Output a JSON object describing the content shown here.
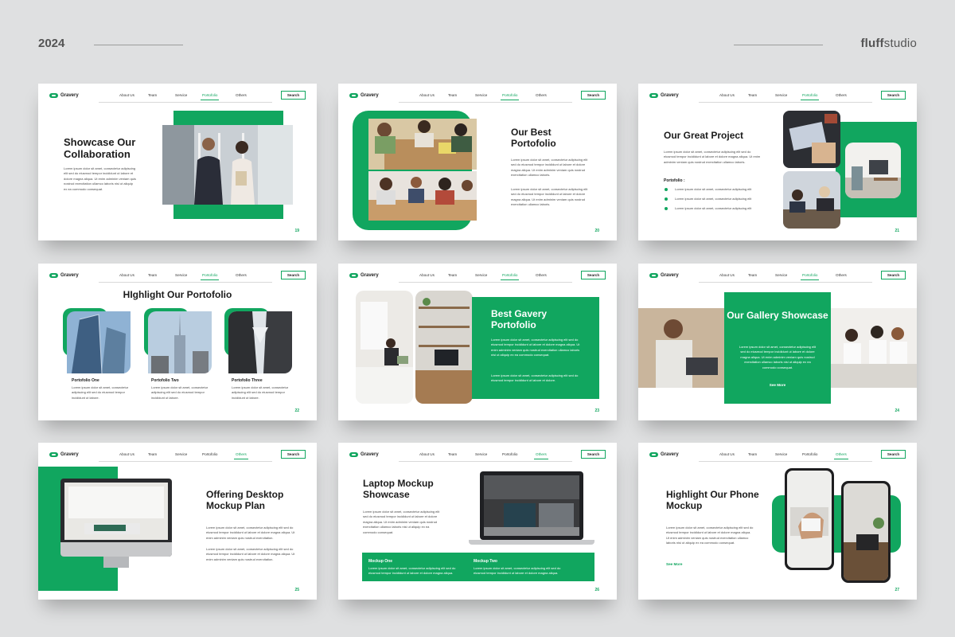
{
  "header": {
    "year": "2024",
    "brand_bold": "fluff",
    "brand_light": "studio"
  },
  "nav": {
    "logo": "Gravery",
    "items": [
      "About Us",
      "Team",
      "Service",
      "Portofolio",
      "Others"
    ],
    "search": "Search"
  },
  "colors": {
    "accent": "#11a65f",
    "background": "#dfe0e1"
  },
  "slides": [
    {
      "num": "19",
      "title": "Showcase Our Collaboration",
      "body": "Lorem ipsum dolor sit amet, consectetur adipiscing elit sed do eiusmod tempor incididunt ut labore et dolore magna aliqua. Ut enim adminim veniam quis nostrud exercitation ullamco laboris nisi ut aliquip ex ea commodo consequat."
    },
    {
      "num": "20",
      "title": "Our Best Portofolio",
      "body1": "Lorem ipsum dolor sit amet, consectetur adipiscing elit sed do eiusmod tempor incididunt ut labore et dolore magna aliqua. Ut enim adminim veniam quis nostrud exercitation ullamco laboris.",
      "body2": "Lorem ipsum dolor sit amet, consectetur adipiscing elit sed do eiusmod tempor incididunt ut labore et dolore magna aliqua. Ut enim adminim veniam quis nostrud exercitation ullamco laboris."
    },
    {
      "num": "21",
      "title": "Our Great Project",
      "body": "Lorem ipsum dolor sit amet, consectetur adipiscing elit sed do eiusmod tempor incididunt ut labore et dolore magna aliqua. Ut enim adminim veniam quis nostrud exercitation ullamco laboris.",
      "list_label": "Portofolio :",
      "items": [
        "Lorem ipsum dolor sit amet, consectetur adipiscing elit",
        "Lorem ipsum dolor sit amet, consectetur adipiscing elit",
        "Lorem ipsum dolor sit amet, consectetur adipiscing elit"
      ]
    },
    {
      "num": "22",
      "title": "HIghlight Our Portofolio",
      "cards": [
        {
          "label": "Portofolio One",
          "text": "Lorem ipsum dolor sit amet, consectetur adipiscing elit sed do eiusmod tempor incididunt ut labore."
        },
        {
          "label": "Portofolio Two",
          "text": "Lorem ipsum dolor sit amet, consectetur adipiscing elit sed do eiusmod tempor incididunt ut labore."
        },
        {
          "label": "Portofolio Three",
          "text": "Lorem ipsum dolor sit amet, consectetur adipiscing elit sed do eiusmod tempor incididunt ut labore."
        }
      ]
    },
    {
      "num": "23",
      "title": "Best Gavery Portofolio",
      "body1": "Lorem ipsum dolor sit amet, consectetur adipiscing elit sed do eiusmod tempor incididunt ut labore et dolore magna aliqua. Ut enim adminim veniam quis nostrud exercitation ullamco laboris nisi ut aliquip ex ea commodo consequat.",
      "body2": "Lorem ipsum dolor sit amet, consectetur adipiscing elit sed do eiusmod tempor incididunt ut labore et dolore."
    },
    {
      "num": "24",
      "title": "Our Gallery Showcase",
      "body": "Lorem ipsum dolor sit amet, consectetur adipiscing elit sed do eiusmod tempor incididunt ut labore et dolore magna aliqua. Ut enim adminim veniam quis nostrud exercitation ullamco laboris nisi ut aliquip ex ea commodo consequat.",
      "cta": "See More"
    },
    {
      "num": "25",
      "title": "Offering Desktop Mockup Plan",
      "body1": "Lorem ipsum dolor sit amet, consectetur adipiscing elit sed do eiusmod tempor incididunt ut labore et dolore magna aliqua. Ut enim adminim veniam quis nostrud exercitation.",
      "body2": "Lorem ipsum dolor sit amet, consectetur adipiscing elit sed do eiusmod tempor incididunt ut labore et dolore magna aliqua. Ut enim adminim veniam quis nostrud exercitation."
    },
    {
      "num": "26",
      "title": "Laptop Mockup Showcase",
      "body": "Lorem ipsum dolor sit amet, consectetur adipiscing elit sed do eiusmod tempor incididunt ut labore et dolore magna aliqua. Ut enim adminim veniam quis nostrud exercitation ullamco laboris nisi ut aliquip ex ea commodo consequat.",
      "m1_label": "Mockup One",
      "m1_text": "Lorem ipsum dolor sit amet, consectetur adipiscing elit sed do eiusmod tempor incididunt ut labore et dolore magna aliqua.",
      "m2_label": "Mockup Two",
      "m2_text": "Lorem ipsum dolor sit amet, consectetur adipiscing elit sed do eiusmod tempor incididunt ut labore et dolore magna aliqua."
    },
    {
      "num": "27",
      "title": "Highlight Our Phone Mockup",
      "body": "Lorem ipsum dolor sit amet, consectetur adipiscing elit sed do eiusmod tempor incididunt ut labore et dolore magna aliqua. Ut enim adminim veniam quis nostrud exercitation ullamco laboris nisi ut aliquip ex ea commodo consequat.",
      "cta": "See More"
    }
  ]
}
